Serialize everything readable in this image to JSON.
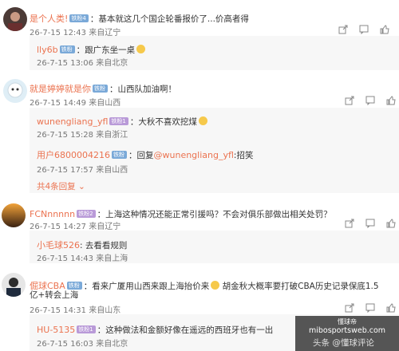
{
  "comments": [
    {
      "username": "是个人类!",
      "badge": "铁粉4",
      "text": "基本就这几个国企轮番报价了...价高者得",
      "time": "26-7-15 12:43",
      "location": "来自辽宁",
      "replies": [
        {
          "username": "lly6b",
          "badge": "铁粉",
          "text": "跟广东坐一桌",
          "time": "26-7-15 13:06",
          "location": "来自北京"
        }
      ]
    },
    {
      "username": "就是婷婷就是你",
      "badge": "铁粉",
      "text": "山西队加油啊！",
      "time": "26-7-15 14:49",
      "location": "来自山西",
      "replies": [
        {
          "username": "wunengliang_yfl",
          "badge": "铁粉1",
          "text": "大秋不喜欢挖煤",
          "time": "26-7-15 15:28",
          "location": "来自浙江"
        },
        {
          "username": "用户6800004216",
          "badge": "铁粉",
          "text": "回复",
          "mention": "@wunengliang_yfl",
          "text_after": ":招笑",
          "time": "26-7-15 17:57",
          "location": "来自山西"
        }
      ],
      "more_replies": "共4条回复"
    },
    {
      "username": "FCNnnnnn",
      "badge": "铁粉2",
      "text": "上海这种情况还能正常引援吗？不会对俱乐部做出相关处罚？",
      "time": "26-7-15 14:27",
      "location": "来自辽宁",
      "replies": [
        {
          "username": "小毛球526",
          "text": "去看看规则",
          "time": "26-7-15 14:43",
          "location": "来自上海"
        }
      ]
    },
    {
      "username": "倔球CBA",
      "badge": "铁粉",
      "text_line1": "看来广厦用山西来跟上海抬价来",
      "text_line1b": "胡金秋大概率要打破CBA历史记录保底1.5",
      "text_line2": "亿+转会上海",
      "time": "26-7-15 14:31",
      "location": "来自山东",
      "replies": [
        {
          "username": "HU-5135",
          "badge": "铁粉1",
          "text": "这种做法和金额好像在遥远的西班牙也有一出",
          "time": "26-7-15 16:03",
          "location": "来自北京"
        }
      ]
    }
  ],
  "watermark": {
    "top": "懂球帝",
    "site": "mibosportsweb.com",
    "bottom": "头条 @懂球评论"
  },
  "colors": {
    "username": "#eb7350",
    "reply_bg": "#f7f7f7",
    "badge_blue": "#7aa9d8",
    "badge_purple": "#b99ad8"
  }
}
